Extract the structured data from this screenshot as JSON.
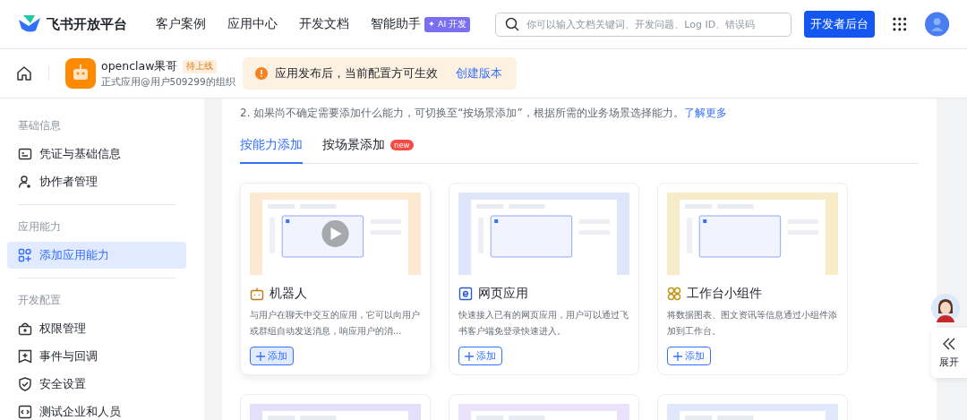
{
  "header": {
    "logo_text": "飞书开放平台",
    "nav": [
      {
        "label": "客户案例"
      },
      {
        "label": "应用中心"
      },
      {
        "label": "开发文档"
      },
      {
        "label": "智能助手",
        "badge": "✦ AI 开发"
      }
    ],
    "search": {
      "placeholder": "你可以输入文档关键词、开发问题、Log ID、错误码"
    },
    "console_button": "开发者后台"
  },
  "app_bar": {
    "app_name": "openclaw果哥",
    "status": "待上线",
    "org": "正式应用@用户509299的组织",
    "notice": {
      "text": "应用发布后，当前配置方可生效",
      "link": "创建版本"
    }
  },
  "sidebar": [
    {
      "title": "基础信息",
      "items": [
        {
          "label": "凭证与基础信息",
          "selected": false
        },
        {
          "label": "协作者管理",
          "selected": false
        }
      ]
    },
    {
      "title": "应用能力",
      "items": [
        {
          "label": "添加应用能力",
          "selected": true
        }
      ]
    },
    {
      "title": "开发配置",
      "items": [
        {
          "label": "权限管理",
          "selected": false
        },
        {
          "label": "事件与回调",
          "selected": false
        },
        {
          "label": "安全设置",
          "selected": false
        },
        {
          "label": "测试企业和人员",
          "selected": false
        }
      ]
    }
  ],
  "content": {
    "tips": [
      {
        "text": "2. 如果尚不确定需要添加什么能力，可切换至“按场景添加”，根据所需的业务场景选择能力。",
        "link": "了解更多"
      }
    ],
    "tabs": [
      {
        "label": "按能力添加",
        "selected": true
      },
      {
        "label": "按场景添加",
        "selected": false,
        "badge": "new"
      }
    ],
    "cards": [
      {
        "kind": "capability",
        "title": "机器人",
        "description": "与用户在聊天中交互的应用，它可以向用户或群组自动发送消息，响应用户的消...",
        "button": "添加",
        "hovered": true,
        "color": "#fde8d2"
      },
      {
        "kind": "capability",
        "title": "网页应用",
        "description": "快速接入已有的网页应用，用户可以通过飞书客户端免登录快速进入。",
        "button": "添加",
        "hovered": false,
        "color": "#dfe5fb"
      },
      {
        "kind": "capability",
        "title": "工作台小组件",
        "description": "将数据图表、图文资讯等信息通过小组件添加到工作台。",
        "button": "添加",
        "hovered": false,
        "color": "#f8ecc8"
      },
      {
        "kind": "preview_only",
        "color": "#e3e0fb"
      },
      {
        "kind": "preview_only",
        "color": "#ebe2fb"
      },
      {
        "kind": "preview_only",
        "color": "#e2e8fb"
      }
    ]
  },
  "side_widget": {
    "label": "展开"
  }
}
